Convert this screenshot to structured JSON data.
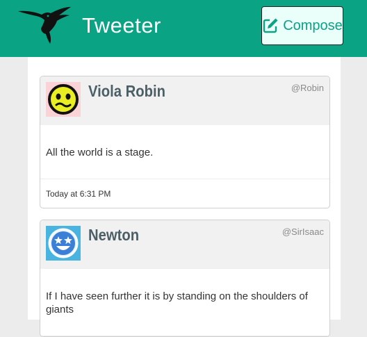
{
  "header": {
    "brand": "Tweeter",
    "compose_label": "Compose",
    "logo_icon": "hummingbird-icon",
    "compose_icon": "edit-icon"
  },
  "colors": {
    "accent": "#0aa383",
    "compose_bg": "#eafffa"
  },
  "tweets": [
    {
      "name": "Viola Robin",
      "handle": "@Robin",
      "text": "All the world is a stage.",
      "time": "Today at 6:31 PM",
      "avatar_icon": "yellow-smiley-avatar"
    },
    {
      "name": "Newton",
      "handle": "@SirIsaac",
      "text": "If I have seen further it is by standing on the shoulders of giants",
      "avatar_icon": "blue-starry-smiley-avatar"
    }
  ]
}
